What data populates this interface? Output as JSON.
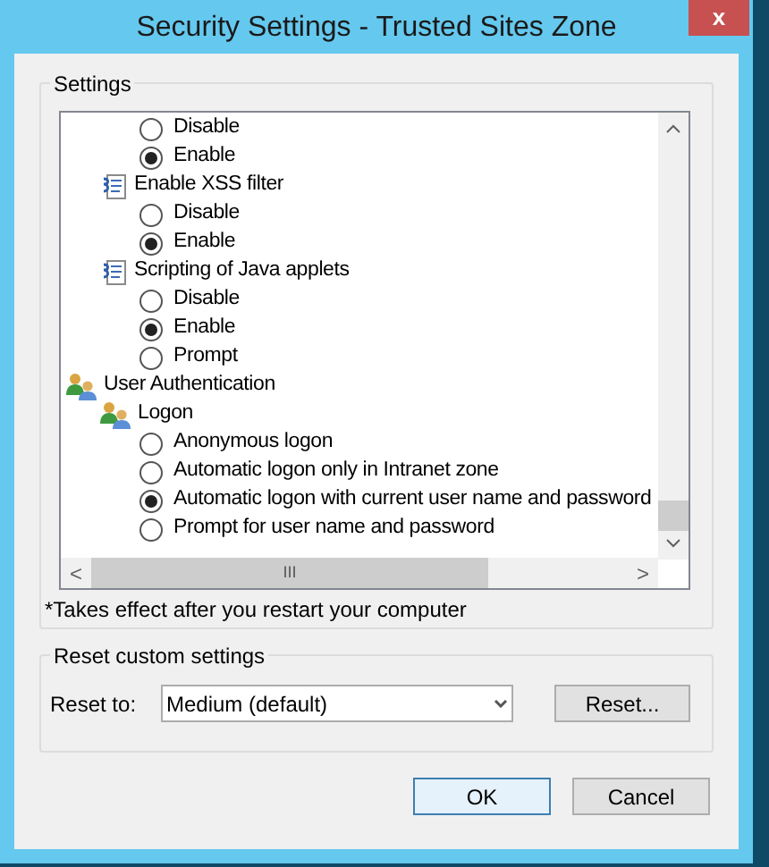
{
  "window": {
    "title": "Security Settings - Trusted Sites Zone",
    "close": "x"
  },
  "settings": {
    "title": "Settings",
    "tree": [
      {
        "kind": "offscreen",
        "children": [
          {
            "kind": "offscreen",
            "children": [
              {
                "kind": "radio",
                "label": "Disable",
                "selected": false
              },
              {
                "kind": "radio",
                "label": "Enable",
                "selected": true
              }
            ]
          },
          {
            "kind": "script",
            "label": "Enable XSS filter",
            "children": [
              {
                "kind": "radio",
                "label": "Disable",
                "selected": false
              },
              {
                "kind": "radio",
                "label": "Enable",
                "selected": true
              }
            ]
          },
          {
            "kind": "script",
            "label": "Scripting of Java applets",
            "children": [
              {
                "kind": "radio",
                "label": "Disable",
                "selected": false
              },
              {
                "kind": "radio",
                "label": "Enable",
                "selected": true
              },
              {
                "kind": "radio",
                "label": "Prompt",
                "selected": false
              }
            ]
          }
        ]
      },
      {
        "kind": "users",
        "label": "User Authentication",
        "children": [
          {
            "kind": "users",
            "label": "Logon",
            "children": [
              {
                "kind": "radio",
                "label": "Anonymous logon",
                "selected": false
              },
              {
                "kind": "radio",
                "label": "Automatic logon only in Intranet zone",
                "selected": false
              },
              {
                "kind": "radio",
                "label": "Automatic logon with current user name and password",
                "selected": true
              },
              {
                "kind": "radio",
                "label": "Prompt for user name and password",
                "selected": false
              }
            ]
          }
        ]
      }
    ],
    "scroll_left": "<",
    "scroll_grip": "III",
    "scroll_right": ">",
    "note": "*Takes effect after you restart your computer"
  },
  "reset": {
    "title": "Reset custom settings",
    "label": "Reset to:",
    "value": "Medium (default)",
    "button": "Reset..."
  },
  "buttons": [
    {
      "label": "OK",
      "default": true
    },
    {
      "label": "Cancel",
      "default": false
    }
  ]
}
